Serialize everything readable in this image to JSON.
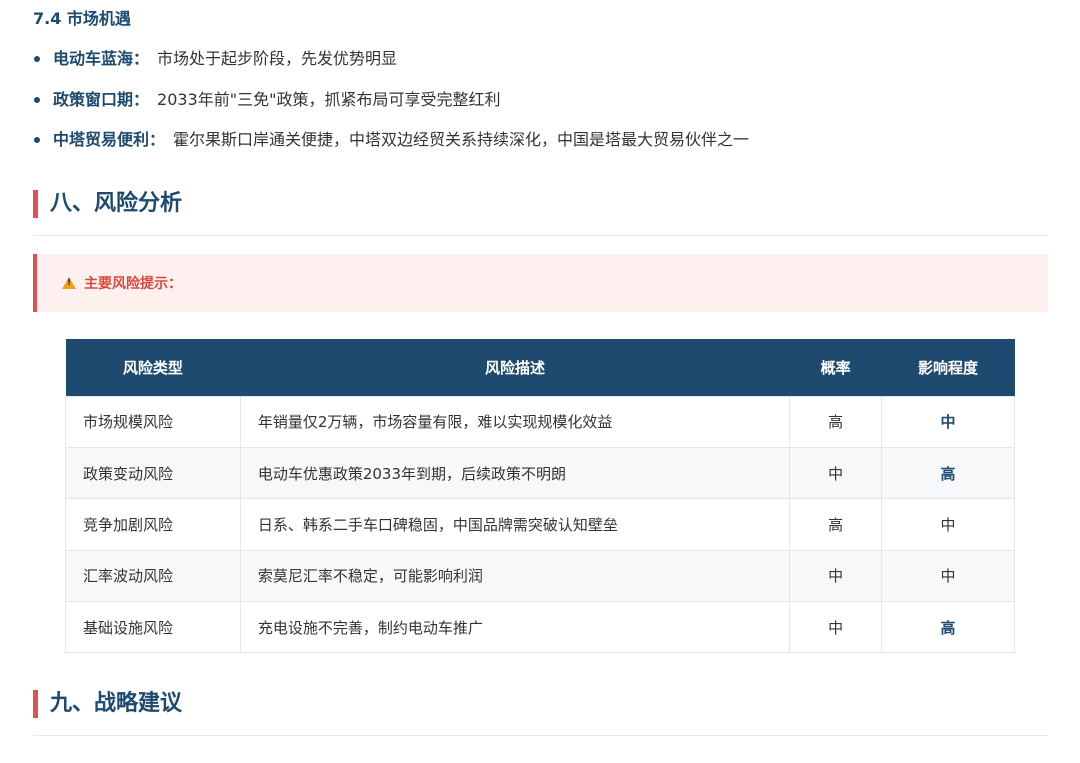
{
  "subsection": {
    "title": "7.4 市场机遇"
  },
  "opportunities": [
    {
      "label": "电动车蓝海：",
      "text": "市场处于起步阶段，先发优势明显"
    },
    {
      "label": "政策窗口期：",
      "text": "2033年前\"三免\"政策，抓紧布局可享受完整红利"
    },
    {
      "label": "中塔贸易便利：",
      "text": "霍尔果斯口岸通关便捷，中塔双边经贸关系持续深化，中国是塔最大贸易伙伴之一"
    }
  ],
  "section8": {
    "title": "八、风险分析"
  },
  "alert": {
    "icon": "warning-icon",
    "text": "主要风险提示：",
    "color": "#d94a3c"
  },
  "risk_table": {
    "headers": [
      "风险类型",
      "风险描述",
      "概率",
      "影响程度"
    ],
    "rows": [
      {
        "type": "市场规模风险",
        "desc": "年销量仅2万辆，市场容量有限，难以实现规模化效益",
        "prob": "高",
        "impact": "中"
      },
      {
        "type": "政策变动风险",
        "desc": "电动车优惠政策2033年到期，后续政策不明朗",
        "prob": "中",
        "impact": "高"
      },
      {
        "type": "竞争加剧风险",
        "desc": "日系、韩系二手车口碑稳固，中国品牌需突破认知壁垒",
        "prob": "高",
        "impact": "中"
      },
      {
        "type": "汇率波动风险",
        "desc": "索莫尼汇率不稳定，可能影响利润",
        "prob": "中",
        "impact": "中"
      },
      {
        "type": "基础设施风险",
        "desc": "充电设施不完善，制约电动车推广",
        "prob": "中",
        "impact": "高"
      }
    ]
  },
  "section9": {
    "title": "九、战略建议"
  },
  "colors": {
    "primary": "#1d4a6e",
    "accent": "#e05050",
    "alert_bg": "#fdf0ef"
  }
}
